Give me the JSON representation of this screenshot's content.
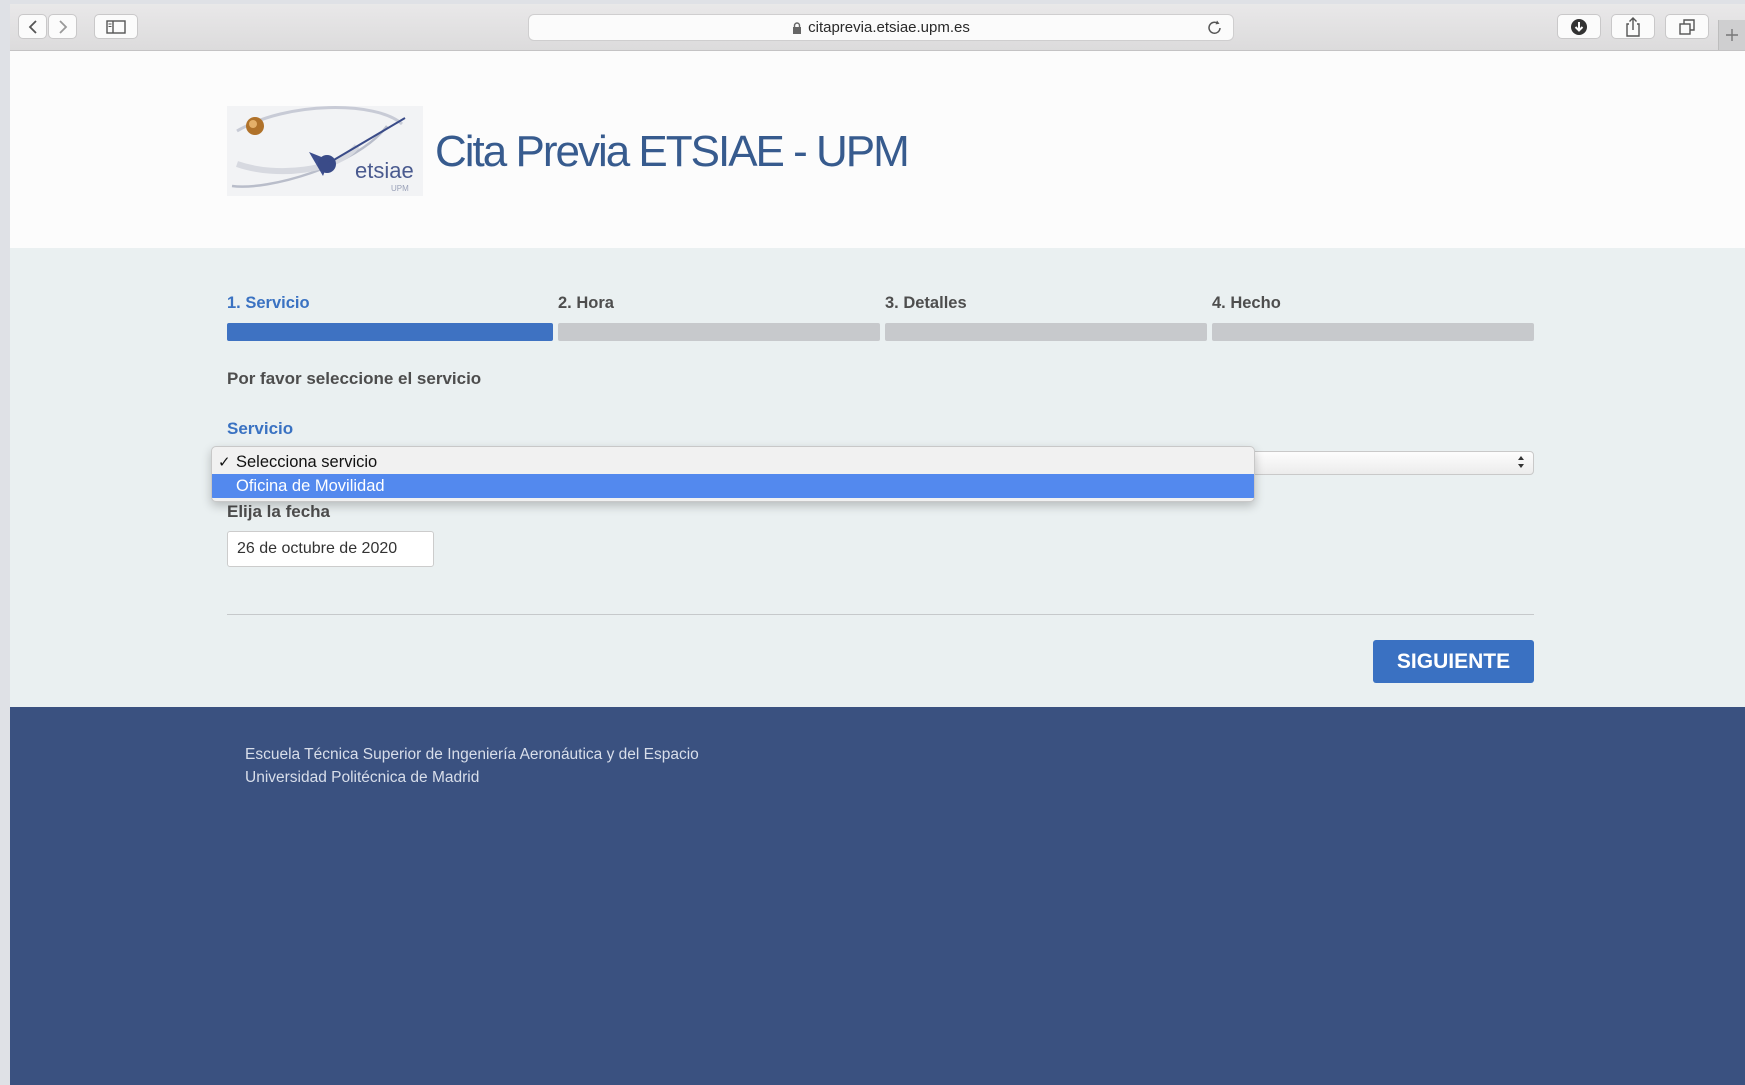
{
  "browser": {
    "url": "citaprevia.etsiae.upm.es"
  },
  "header": {
    "logo_text": "etsiae",
    "logo_subtext": "UPM",
    "title": "Cita Previa ETSIAE - UPM"
  },
  "steps": [
    {
      "label": "1. Servicio",
      "active": true
    },
    {
      "label": "2. Hora",
      "active": false
    },
    {
      "label": "3. Detalles",
      "active": false
    },
    {
      "label": "4. Hecho",
      "active": false
    }
  ],
  "form": {
    "instruction": "Por favor seleccione el servicio",
    "service_label": "Servicio",
    "service_options": [
      "Selecciona servicio",
      "Oficina de Movilidad"
    ],
    "selected_option": "Selecciona servicio",
    "highlighted_option": "Oficina de Movilidad",
    "date_label": "Elija la fecha",
    "date_value": "26 de octubre de 2020",
    "next_button": "SIGUIENTE"
  },
  "footer": {
    "line1": "Escuela Técnica Superior de Ingeniería Aeronáutica y del Espacio",
    "line2": "Universidad Politécnica de Madrid"
  },
  "colors": {
    "accent": "#3a72c2",
    "footer_bg": "#3a5180",
    "main_bg": "#eaf0f1",
    "highlight": "#5389ee"
  },
  "icons": {
    "back": "chevron-left-icon",
    "forward": "chevron-right-icon",
    "sidebar": "sidebar-icon",
    "lock": "lock-icon",
    "reload": "reload-icon",
    "downloads": "download-icon",
    "share": "share-icon",
    "tabs": "tabs-icon",
    "new_tab": "plus-icon",
    "check": "checkmark-icon"
  }
}
